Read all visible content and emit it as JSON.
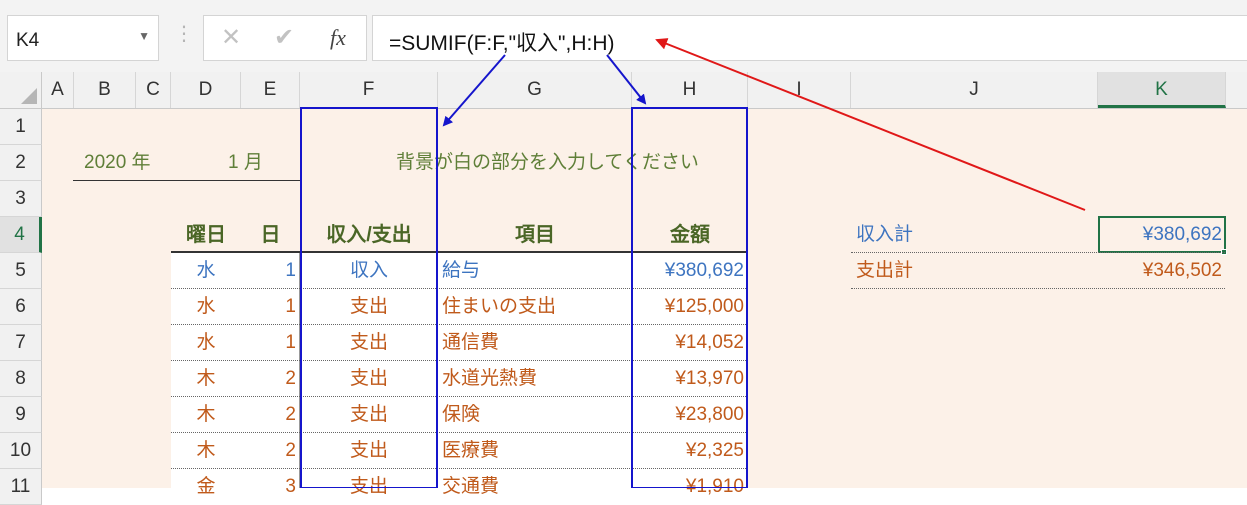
{
  "name_box": {
    "value": "K4"
  },
  "formula_bar": {
    "formula": "=SUMIF(F:F,\"収入\",H:H)",
    "cancel_icon": "✕",
    "enter_icon": "✔",
    "fx_label": "fx"
  },
  "columns": [
    "A",
    "B",
    "C",
    "D",
    "E",
    "F",
    "G",
    "H",
    "I",
    "J",
    "K"
  ],
  "rows": [
    "1",
    "2",
    "3",
    "4",
    "5",
    "6",
    "7",
    "8",
    "9",
    "10",
    "11"
  ],
  "header_row": {
    "year": "2020 年",
    "month": "1 月",
    "instruction": "背景が白の部分を入力してください"
  },
  "table": {
    "headers": [
      "曜日",
      "日",
      "収入/支出",
      "項目",
      "金額"
    ],
    "rows": [
      {
        "weekday": "水",
        "day": "1",
        "type": "収入",
        "item": "給与",
        "amount": "¥380,692"
      },
      {
        "weekday": "水",
        "day": "1",
        "type": "支出",
        "item": "住まいの支出",
        "amount": "¥125,000"
      },
      {
        "weekday": "水",
        "day": "1",
        "type": "支出",
        "item": "通信費",
        "amount": "¥14,052"
      },
      {
        "weekday": "木",
        "day": "2",
        "type": "支出",
        "item": "水道光熱費",
        "amount": "¥13,970"
      },
      {
        "weekday": "木",
        "day": "2",
        "type": "支出",
        "item": "保険",
        "amount": "¥23,800"
      },
      {
        "weekday": "木",
        "day": "2",
        "type": "支出",
        "item": "医療費",
        "amount": "¥2,325"
      },
      {
        "weekday": "金",
        "day": "3",
        "type": "支出",
        "item": "交通費",
        "amount": "¥1,910"
      }
    ]
  },
  "summary": {
    "income_label": "収入計",
    "income_value": "¥380,692",
    "expense_label": "支出計",
    "expense_value": "¥346,502"
  },
  "colors": {
    "income": "#3d74c0",
    "expense": "#c05a1b",
    "header_text": "#4a6626",
    "selection": "#217346",
    "background_cells": "#fcf1e8",
    "annotation_blue": "#1515cc",
    "annotation_red": "#e01818"
  }
}
